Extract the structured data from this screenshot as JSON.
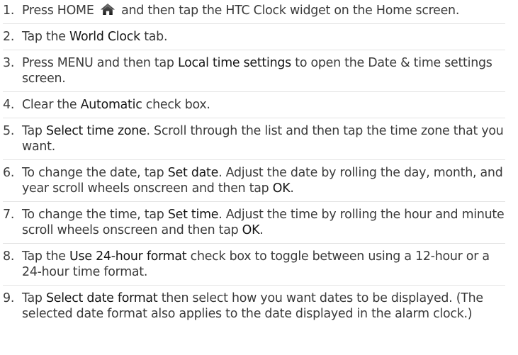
{
  "steps": [
    {
      "number": "1.",
      "parts": [
        {
          "text": "Press HOME "
        },
        {
          "icon": "home-icon"
        },
        {
          "text": " and then tap the HTC Clock widget on the Home screen."
        }
      ]
    },
    {
      "number": "2.",
      "parts": [
        {
          "text": "Tap the "
        },
        {
          "text": "World Clock",
          "hl": true
        },
        {
          "text": " tab."
        }
      ]
    },
    {
      "number": "3.",
      "parts": [
        {
          "text": "Press MENU and then tap "
        },
        {
          "text": "Local time settings",
          "hl": true
        },
        {
          "text": " to open the Date & time settings screen."
        }
      ]
    },
    {
      "number": "4.",
      "parts": [
        {
          "text": "Clear the "
        },
        {
          "text": "Automatic",
          "hl": true
        },
        {
          "text": " check box."
        }
      ]
    },
    {
      "number": "5.",
      "parts": [
        {
          "text": "Tap "
        },
        {
          "text": "Select time zone",
          "hl": true
        },
        {
          "text": ". Scroll through the list and then tap the time zone that you want."
        }
      ]
    },
    {
      "number": "6.",
      "parts": [
        {
          "text": "To change the date, tap "
        },
        {
          "text": "Set date",
          "hl": true
        },
        {
          "text": ". Adjust the date by rolling the day, month, and year scroll wheels onscreen and then tap "
        },
        {
          "text": "OK",
          "hl": true
        },
        {
          "text": "."
        }
      ]
    },
    {
      "number": "7.",
      "parts": [
        {
          "text": "To change the time, tap "
        },
        {
          "text": "Set time",
          "hl": true
        },
        {
          "text": ". Adjust the time by rolling the hour and minute scroll wheels onscreen and then tap "
        },
        {
          "text": "OK",
          "hl": true
        },
        {
          "text": "."
        }
      ]
    },
    {
      "number": "8.",
      "parts": [
        {
          "text": "Tap the "
        },
        {
          "text": "Use 24-hour format",
          "hl": true
        },
        {
          "text": " check box to toggle between using a 12-hour or a 24-hour time format."
        }
      ]
    },
    {
      "number": "9.",
      "parts": [
        {
          "text": "Tap "
        },
        {
          "text": "Select date format",
          "hl": true
        },
        {
          "text": " then select how you want dates to be displayed. (The selected date format also applies to the date displayed in the alarm clock.)"
        }
      ]
    }
  ]
}
